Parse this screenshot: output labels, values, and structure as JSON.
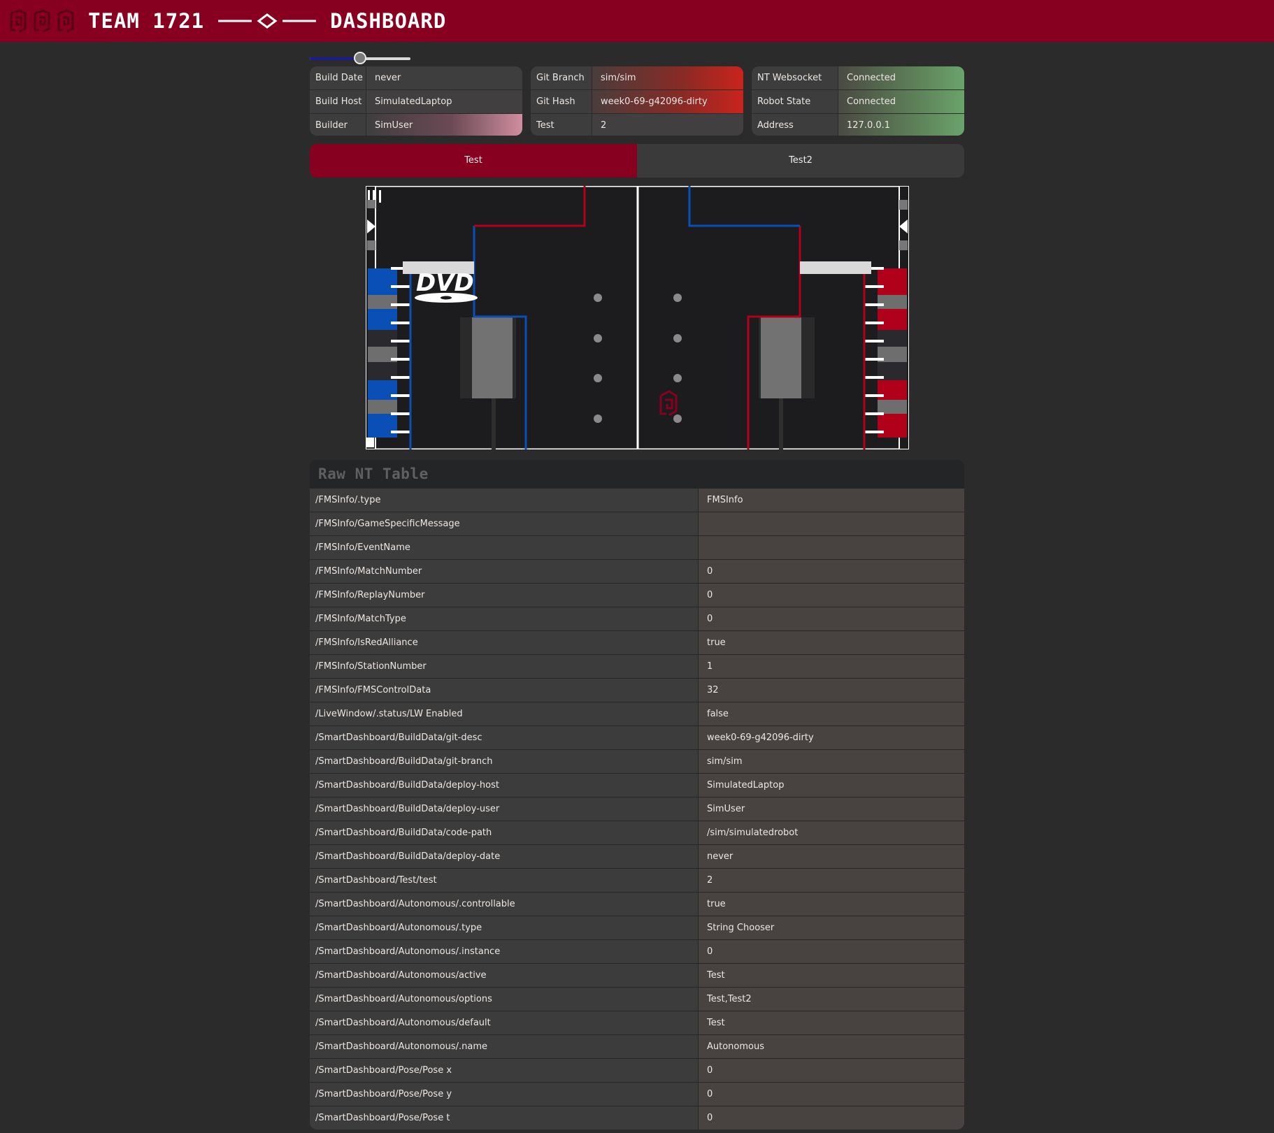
{
  "header": {
    "title": "TEAM 1721",
    "subtitle": "DASHBOARD",
    "logo_icon": "team-logo-icon",
    "accent_color": "#880020"
  },
  "slider": {
    "value_fraction": 0.5
  },
  "build_card": {
    "rows": [
      {
        "label": "Build Date",
        "value": "never"
      },
      {
        "label": "Build Host",
        "value": "SimulatedLaptop"
      },
      {
        "label": "Builder",
        "value": "SimUser"
      }
    ]
  },
  "git_card": {
    "rows": [
      {
        "label": "Git Branch",
        "value": "sim/sim"
      },
      {
        "label": "Git Hash",
        "value": "week0-69-g42096-dirty"
      },
      {
        "label": "Test",
        "value": "2"
      }
    ]
  },
  "status_card": {
    "rows": [
      {
        "label": "NT Websocket",
        "value": "Connected"
      },
      {
        "label": "Robot State",
        "value": "Connected"
      },
      {
        "label": "Address",
        "value": "127.0.0.1"
      }
    ],
    "status_color": "#6aa36a"
  },
  "tabs": [
    {
      "label": "Test",
      "active": true
    },
    {
      "label": "Test2",
      "active": false
    }
  ],
  "field": {
    "blue_color": "#0a4fb5",
    "red_color": "#b0001a",
    "logo_text": "DVD"
  },
  "raw_table": {
    "title": "Raw NT Table",
    "rows": [
      {
        "key": "/FMSInfo/.type",
        "value": "FMSInfo"
      },
      {
        "key": "/FMSInfo/GameSpecificMessage",
        "value": ""
      },
      {
        "key": "/FMSInfo/EventName",
        "value": ""
      },
      {
        "key": "/FMSInfo/MatchNumber",
        "value": "0"
      },
      {
        "key": "/FMSInfo/ReplayNumber",
        "value": "0"
      },
      {
        "key": "/FMSInfo/MatchType",
        "value": "0"
      },
      {
        "key": "/FMSInfo/IsRedAlliance",
        "value": "true"
      },
      {
        "key": "/FMSInfo/StationNumber",
        "value": "1"
      },
      {
        "key": "/FMSInfo/FMSControlData",
        "value": "32"
      },
      {
        "key": "/LiveWindow/.status/LW Enabled",
        "value": "false"
      },
      {
        "key": "/SmartDashboard/BuildData/git-desc",
        "value": "week0-69-g42096-dirty"
      },
      {
        "key": "/SmartDashboard/BuildData/git-branch",
        "value": "sim/sim"
      },
      {
        "key": "/SmartDashboard/BuildData/deploy-host",
        "value": "SimulatedLaptop"
      },
      {
        "key": "/SmartDashboard/BuildData/deploy-user",
        "value": "SimUser"
      },
      {
        "key": "/SmartDashboard/BuildData/code-path",
        "value": "/sim/simulatedrobot"
      },
      {
        "key": "/SmartDashboard/BuildData/deploy-date",
        "value": "never"
      },
      {
        "key": "/SmartDashboard/Test/test",
        "value": "2"
      },
      {
        "key": "/SmartDashboard/Autonomous/.controllable",
        "value": "true"
      },
      {
        "key": "/SmartDashboard/Autonomous/.type",
        "value": "String Chooser"
      },
      {
        "key": "/SmartDashboard/Autonomous/.instance",
        "value": "0"
      },
      {
        "key": "/SmartDashboard/Autonomous/active",
        "value": "Test"
      },
      {
        "key": "/SmartDashboard/Autonomous/options",
        "value": "Test,Test2"
      },
      {
        "key": "/SmartDashboard/Autonomous/default",
        "value": "Test"
      },
      {
        "key": "/SmartDashboard/Autonomous/.name",
        "value": "Autonomous"
      },
      {
        "key": "/SmartDashboard/Pose/Pose x",
        "value": "0"
      },
      {
        "key": "/SmartDashboard/Pose/Pose y",
        "value": "0"
      },
      {
        "key": "/SmartDashboard/Pose/Pose t",
        "value": "0"
      }
    ]
  }
}
